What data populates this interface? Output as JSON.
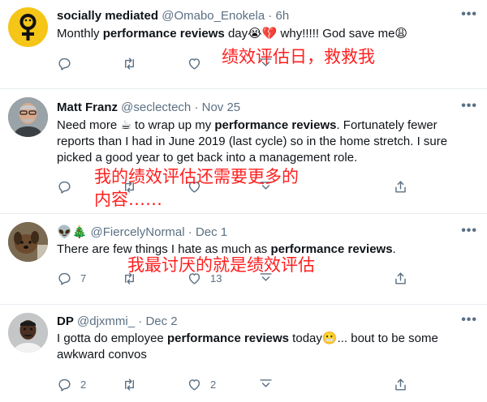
{
  "tweets": [
    {
      "name": "socially mediated",
      "handle": "@Omabo_Enokela",
      "time": "6h",
      "text_before": "Monthly ",
      "text_bold": "performance reviews",
      "text_after": " day",
      "emoji_1": "😭💔",
      "text_after_2": " why!!!!! God save me",
      "emoji_2": "😩",
      "annotation": "绩效评估日，救救我",
      "counts": {
        "reply": "",
        "retweet": "",
        "like": ""
      }
    },
    {
      "name": "Matt Franz",
      "handle": "@seclectech",
      "time": "Nov 25",
      "text_before": "Need more ",
      "emoji_1": "☕",
      "text_mid": " to wrap up my ",
      "text_bold": "performance reviews",
      "text_after": ". Fortunately fewer reports than I had in June 2019 (last cycle) so in the home stretch. I sure picked a good year to get back into a management role.",
      "annotation_line1": "我的绩效评估还需要更多的",
      "annotation_line2": "内容……",
      "counts": {
        "reply": "",
        "retweet": "",
        "like": ""
      }
    },
    {
      "name_emoji": "👽🎄",
      "handle": "@FiercelyNormal",
      "time": "Dec 1",
      "text_before": "There are few things I hate as much as ",
      "text_bold": "performance reviews",
      "text_after": ".",
      "annotation": "我最讨厌的就是绩效评估",
      "counts": {
        "reply": "7",
        "retweet": "",
        "like": "13"
      }
    },
    {
      "name": "DP",
      "handle": "@djxmmi_",
      "time": "Dec 2",
      "text_before": "I gotta do employee ",
      "text_bold": "performance reviews",
      "text_after": " today",
      "emoji_1": "😬",
      "text_after_2": "... bout to be some awkward convos",
      "counts": {
        "reply": "2",
        "retweet": "",
        "like": "2"
      }
    }
  ],
  "separator": "·",
  "more_glyph": "•••",
  "colors": {
    "annotation": "#ff1f1f",
    "secondary": "#5b7083",
    "divider": "#e6ecf0"
  }
}
